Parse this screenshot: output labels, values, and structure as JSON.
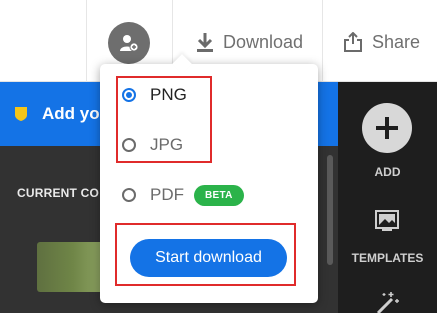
{
  "header": {
    "download_label": "Download",
    "share_label": "Share"
  },
  "banner": {
    "text": "Add yo"
  },
  "panel": {
    "current_label": "CURRENT CO"
  },
  "rail": {
    "add_label": "ADD",
    "templates_label": "TEMPLATES"
  },
  "download_menu": {
    "options": [
      {
        "label": "PNG",
        "selected": true
      },
      {
        "label": "JPG",
        "selected": false
      },
      {
        "label": "PDF",
        "selected": false,
        "badge": "BETA"
      }
    ],
    "start_label": "Start download"
  },
  "colors": {
    "accent": "#1473e6",
    "badge": "#2bb34a",
    "highlight": "#e02b2b",
    "rail": "#1e1e1e",
    "panel": "#323232"
  }
}
